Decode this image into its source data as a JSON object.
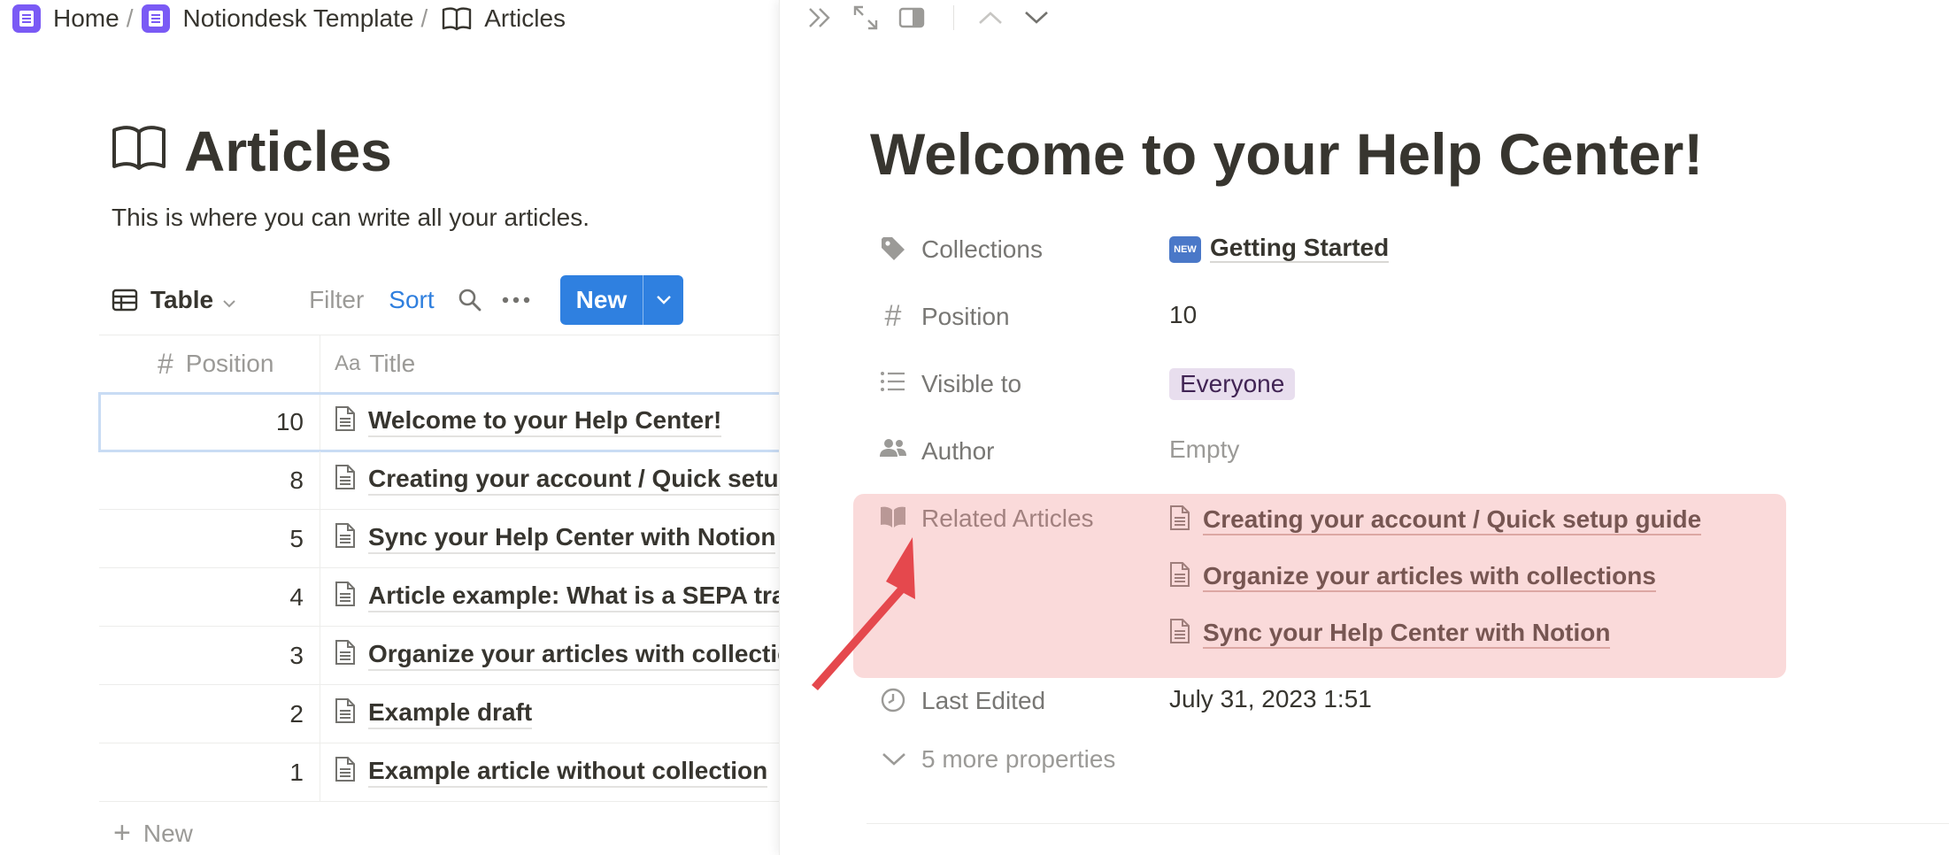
{
  "breadcrumb": [
    {
      "label": "Home",
      "icon": "notiondesk-icon"
    },
    {
      "label": "Notiondesk Template",
      "icon": "notiondesk-icon"
    },
    {
      "label": "Articles",
      "icon": "open-book-icon"
    }
  ],
  "breadcrumb_separator": "/",
  "database": {
    "title": "Articles",
    "description": "This is where you can write all your articles.",
    "view_label": "Table",
    "filter_label": "Filter",
    "sort_label": "Sort",
    "new_label": "New",
    "columns": {
      "position": "Position",
      "title": "Title",
      "title_prefix": "Aa"
    },
    "rows": [
      {
        "position": "10",
        "title": "Welcome to your Help Center!"
      },
      {
        "position": "8",
        "title": "Creating your account / Quick setup guide"
      },
      {
        "position": "5",
        "title": "Sync your Help Center with Notion"
      },
      {
        "position": "4",
        "title": "Article example: What is a SEPA transfer?"
      },
      {
        "position": "3",
        "title": "Organize your articles with collections"
      },
      {
        "position": "2",
        "title": "Example draft"
      },
      {
        "position": "1",
        "title": "Example article without collection"
      }
    ],
    "add_new_label": "New"
  },
  "peek": {
    "title": "Welcome to your Help Center!",
    "properties": {
      "collections": {
        "label": "Collections",
        "badge": "NEW",
        "value": "Getting Started"
      },
      "position": {
        "label": "Position",
        "value": "10"
      },
      "visible_to": {
        "label": "Visible to",
        "value": "Everyone"
      },
      "author": {
        "label": "Author",
        "value": "Empty"
      },
      "related": {
        "label": "Related Articles",
        "items": [
          "Creating your account / Quick setup guide",
          "Organize your articles with collections",
          "Sync your Help Center with Notion"
        ]
      },
      "last_edited": {
        "label": "Last Edited",
        "value": "July 31, 2023 1:51"
      }
    },
    "more_properties": "5 more properties"
  },
  "colors": {
    "accent_blue": "#2f80e0",
    "brand_purple": "#7a5af5",
    "tag_purple_bg": "#e8deee",
    "highlight_red": "#f09696",
    "arrow_red": "#e5484d"
  }
}
